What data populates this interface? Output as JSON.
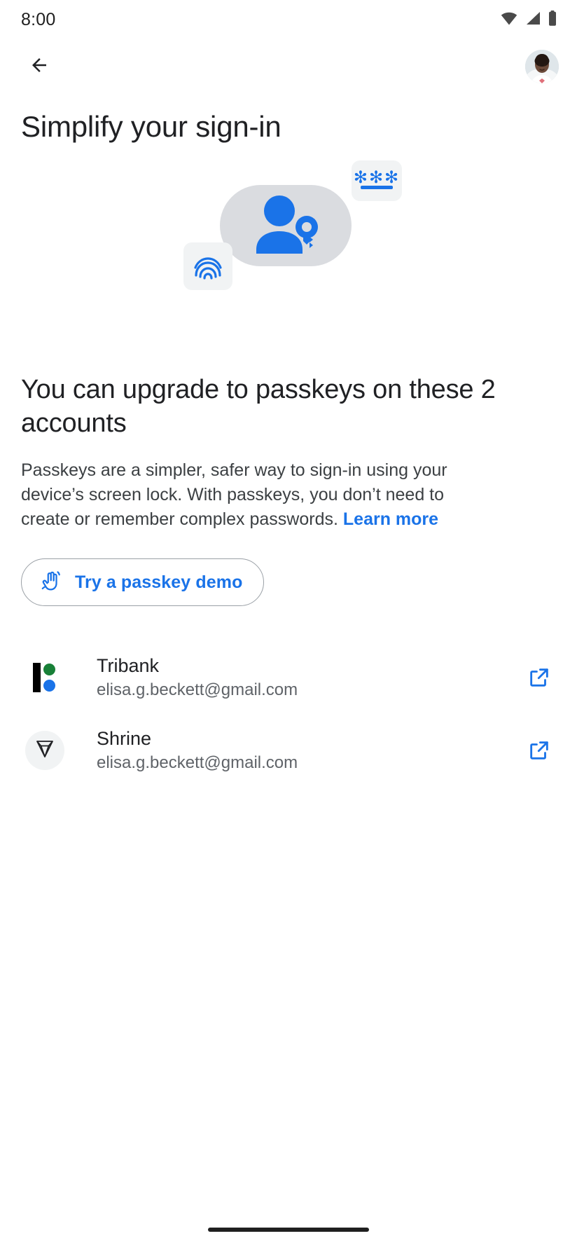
{
  "status_bar": {
    "time": "8:00",
    "icons": [
      "wifi-icon",
      "cellular-signal-icon",
      "battery-icon"
    ]
  },
  "app_bar": {
    "back_icon": "back-arrow-icon",
    "avatar": "account-avatar"
  },
  "page": {
    "title": "Simplify your sign-in"
  },
  "illustration": {
    "name": "passkey-hero-illustration",
    "password_card_stars": "✻✻✻",
    "fingerprint_icon": "fingerprint-icon",
    "person_key_icon": "person-with-key-icon"
  },
  "main": {
    "headline": "You can upgrade to passkeys on these 2 accounts",
    "body_part1": "Passkeys are a simpler, safer way to sign-in using your device’s screen lock. With passkeys, you don’t need to create or remember complex passwords. ",
    "learn_more": "Learn more"
  },
  "demo_button": {
    "label": "Try a passkey demo",
    "icon": "touch-hand-icon"
  },
  "accounts": [
    {
      "name": "Tribank",
      "email": "elisa.g.beckett@gmail.com",
      "logo": "tribank-logo",
      "action_icon": "open-in-new-icon"
    },
    {
      "name": "Shrine",
      "email": "elisa.g.beckett@gmail.com",
      "logo": "shrine-diamond-logo",
      "action_icon": "open-in-new-icon"
    }
  ],
  "colors": {
    "accent_blue": "#1a73e8",
    "text_primary": "#202124",
    "text_secondary": "#5f6368",
    "blob_gray": "#dadce0",
    "card_gray": "#f1f3f4",
    "green": "#188038"
  },
  "nav_bar": {
    "handle": "gesture-nav-handle"
  }
}
